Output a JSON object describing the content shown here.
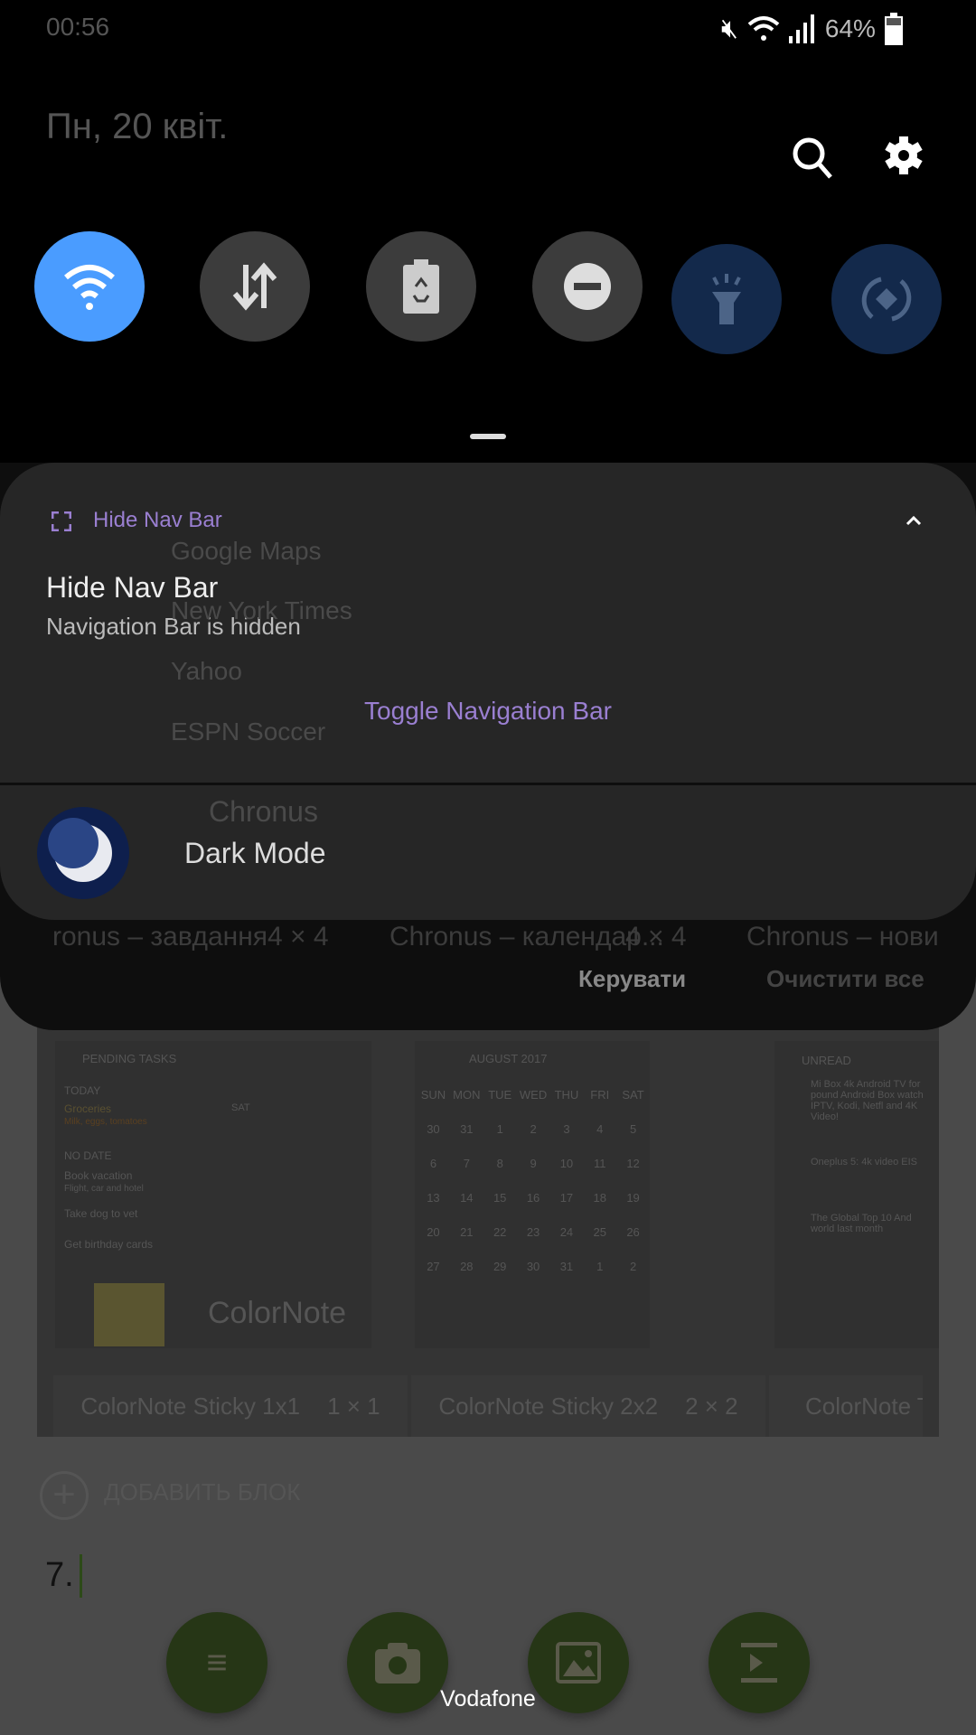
{
  "status_bar": {
    "time": "00:56",
    "battery": "64%",
    "icons": [
      "mute-vibrate-icon",
      "wifi-icon",
      "signal-icon",
      "battery-icon"
    ]
  },
  "header": {
    "date": "Пн, 20 квіт.",
    "search_icon": "search-icon",
    "settings_icon": "gear-icon"
  },
  "quick_tiles": [
    {
      "name": "wifi",
      "icon": "wifi-icon",
      "state": "on"
    },
    {
      "name": "mobile-data",
      "icon": "data-arrows-icon",
      "state": "off"
    },
    {
      "name": "battery-saver",
      "icon": "battery-recycle-icon",
      "state": "off"
    },
    {
      "name": "do-not-disturb",
      "icon": "minus-circle-icon",
      "state": "off"
    },
    {
      "name": "flashlight",
      "icon": "flashlight-icon",
      "state": "unavailable"
    },
    {
      "name": "auto-rotate",
      "icon": "rotate-icon",
      "state": "unavailable"
    }
  ],
  "colors": {
    "accent_purple": "#9a7fd1",
    "wifi_on": "#4a9cff",
    "tile_off": "#3c3c3c",
    "tile_dim": "#13294b",
    "fab_green": "#263616"
  },
  "notification": {
    "app_name": "Hide Nav Bar",
    "title": "Hide Nav Bar",
    "text": "Navigation Bar is hidden",
    "action": "Toggle Navigation Bar"
  },
  "dark_mode": {
    "label": "Dark Mode"
  },
  "footer_actions": {
    "manage": "Керувати",
    "clear_all": "Очистити все"
  },
  "background_app": {
    "list_items": [
      "Google Maps",
      "New York Times",
      "Yahoo",
      "ESPN Soccer"
    ],
    "chronus": "Chronus",
    "widgets": [
      {
        "name": "ronus – завдання",
        "size": "4 × 4"
      },
      {
        "name": "Chronus – календар...",
        "size": "4 × 4"
      },
      {
        "name": "Chronus – нови",
        "size": ""
      }
    ],
    "tasks": {
      "header": "PENDING TASKS",
      "today": "TODAY",
      "groceries": "Groceries",
      "groceries_sub": "Milk, eggs, tomatoes",
      "sat": "SAT",
      "no_date": "NO DATE",
      "book": "Book vacation",
      "book_sub": "Flight, car and hotel",
      "dog": "Take dog to vet",
      "cards": "Get birthday cards"
    },
    "calendar": {
      "header": "AUGUST 2017",
      "days": [
        "SUN",
        "MON",
        "TUE",
        "WED",
        "THU",
        "FRI",
        "SAT"
      ],
      "rows": [
        [
          "30",
          "31",
          "1",
          "2",
          "3",
          "4",
          "5"
        ],
        [
          "6",
          "7",
          "8",
          "9",
          "10",
          "11",
          "12"
        ],
        [
          "13",
          "14",
          "15",
          "16",
          "17",
          "18",
          "19"
        ],
        [
          "20",
          "21",
          "22",
          "23",
          "24",
          "25",
          "26"
        ],
        [
          "27",
          "28",
          "29",
          "30",
          "31",
          "1",
          "2"
        ]
      ]
    },
    "news": {
      "header": "UNREAD",
      "items": [
        "Mi Box 4k Android TV for pound Android Box watch IPTV, Kodi, Netfl and 4K Video!",
        "Oneplus 5: 4k video EIS",
        "The Global Top 10 And world last month"
      ]
    },
    "colornote": "ColorNote",
    "sticky": [
      {
        "name": "ColorNote Sticky 1x1",
        "size": "1 × 1"
      },
      {
        "name": "ColorNote Sticky 2x2",
        "size": "2 × 2"
      },
      {
        "name": "ColorNote T",
        "size": ""
      }
    ],
    "add_block": "ДОБАВИТЬ БЛОК",
    "editor_line": "7."
  },
  "fabs": [
    {
      "icon": "format-list-icon"
    },
    {
      "icon": "camera-icon"
    },
    {
      "icon": "image-icon"
    },
    {
      "icon": "video-insert-icon"
    }
  ],
  "carrier": "Vodafone"
}
